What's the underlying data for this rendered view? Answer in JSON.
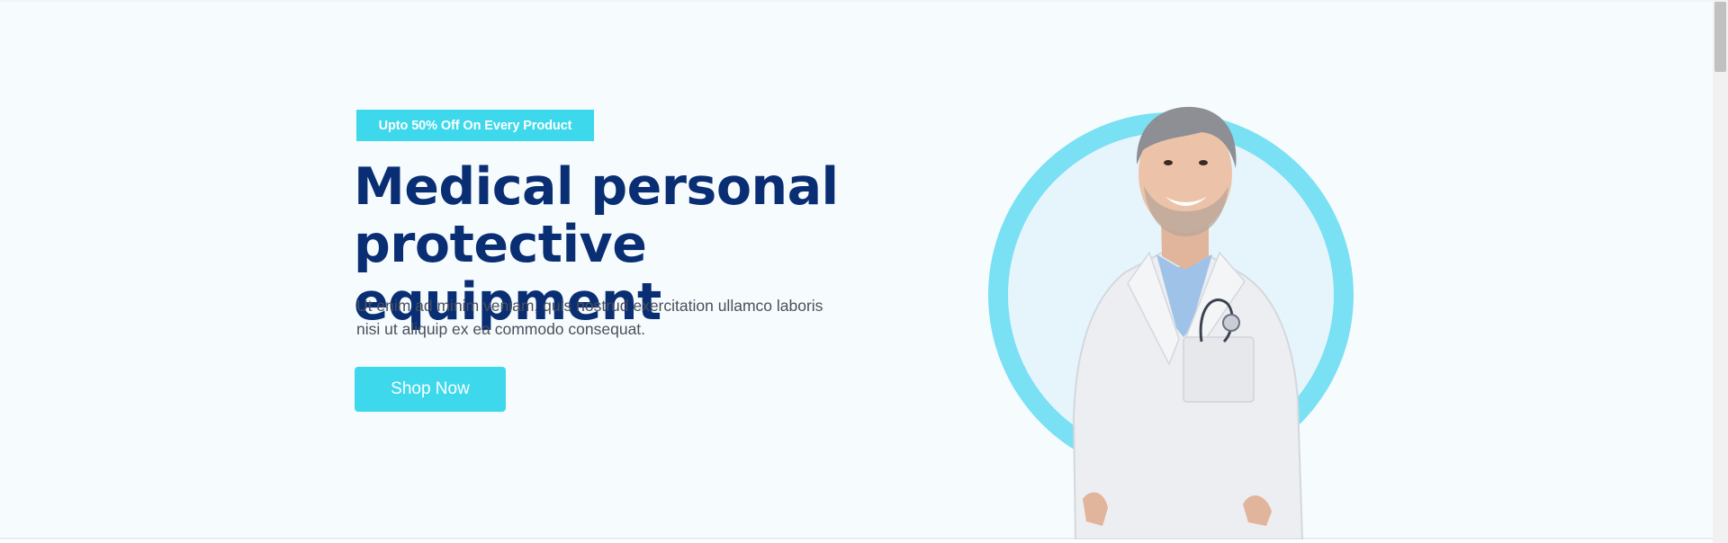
{
  "hero": {
    "badge": "Upto 50% Off On Every Product",
    "title_line1": "Medical personal",
    "title_line2": "protective equipment",
    "description_line1": "Ut enim ad minim veniam, quis nostrud exercitation ullamco laboris",
    "description_line2": "nisi ut aliquip ex ea commodo consequat.",
    "cta_label": "Shop Now"
  },
  "colors": {
    "accent": "#3ed8ec",
    "heading": "#0a2e73",
    "body_text": "#4a4f5c",
    "background": "#f6fcfe",
    "ring": "#7ae0f3",
    "ring_inner": "#e6f5fc"
  },
  "icons": {
    "hero_image": "doctor-portrait-image"
  }
}
